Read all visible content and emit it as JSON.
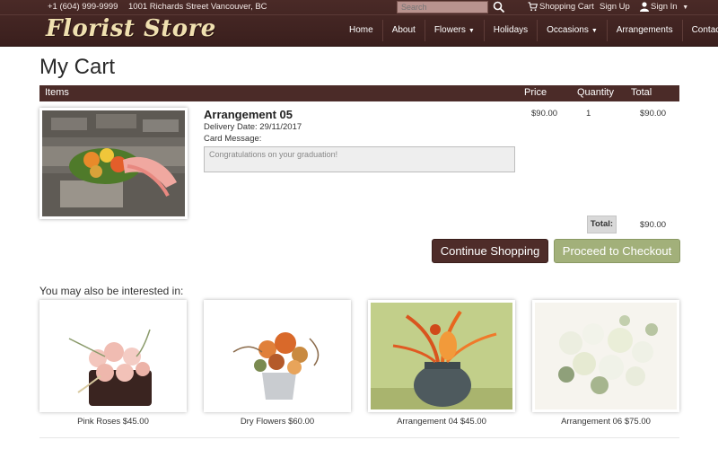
{
  "topbar": {
    "phone": "+1 (604) 999-9999",
    "address": "1001 Richards Street Vancouver, BC",
    "search_placeholder": "Search",
    "cart_label": "Shopping Cart",
    "signup_label": "Sign Up",
    "signin_label": "Sign In"
  },
  "logo": "Florist Store",
  "nav": [
    {
      "label": "Home"
    },
    {
      "label": "About"
    },
    {
      "label": "Flowers"
    },
    {
      "label": "Holidays"
    },
    {
      "label": "Occasions"
    },
    {
      "label": "Arrangements"
    },
    {
      "label": "Contact"
    }
  ],
  "page_title": "My Cart",
  "cart_columns": {
    "items": "Items",
    "price": "Price",
    "quantity": "Quantity",
    "total": "Total"
  },
  "cart_item": {
    "name": "Arrangement 05",
    "delivery": "Delivery Date: 29/11/2017",
    "card_label": "Card Message:",
    "card_message": "Congratulations on your graduation!",
    "price": "$90.00",
    "quantity": "1",
    "total": "$90.00"
  },
  "summary": {
    "total_label": "Total:",
    "total_value": "$90.00"
  },
  "buttons": {
    "continue": "Continue Shopping",
    "checkout": "Proceed to Checkout"
  },
  "suggestions": {
    "title": "You may also be interested in:",
    "items": [
      {
        "caption": "Pink Roses $45.00"
      },
      {
        "caption": "Dry Flowers $60.00"
      },
      {
        "caption": "Arrangement 04 $45.00"
      },
      {
        "caption": "Arrangement 06 $75.00"
      }
    ]
  },
  "colors": {
    "brand_dark": "#4b2b28",
    "accent_green": "#a2b07a",
    "logo": "#f0e0b0"
  }
}
